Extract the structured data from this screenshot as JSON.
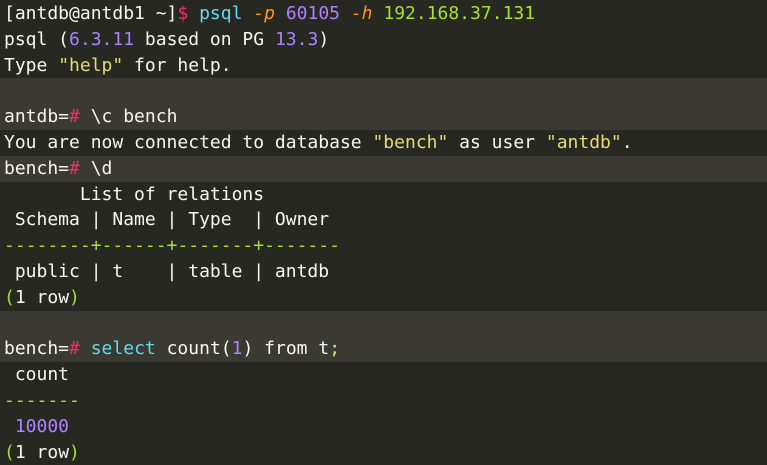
{
  "terminal": {
    "prompt_host": "[antdb@antdb1 ~]",
    "prompt_symbol": "$",
    "cmd_psql": "psql",
    "flag_p": "-p",
    "port": "60105",
    "flag_h": "-h",
    "host": "192.168.37.131",
    "version_prefix": "psql (",
    "version": "6.3.11",
    "version_middle": " based on PG ",
    "pg_version": "13.3",
    "version_suffix": ")",
    "help_prefix": "Type ",
    "help_word": "\"help\"",
    "help_suffix": " for help.",
    "antdb_prompt": "antdb=",
    "hash": "#",
    "cmd_connect": " \\c bench",
    "connected_prefix": "You are now connected to database ",
    "db_name": "\"bench\"",
    "connected_middle": " as user ",
    "user_name": "\"antdb\"",
    "connected_suffix": ".",
    "bench_prompt": "bench=",
    "cmd_d": " \\d",
    "relations_title": "       List of relations",
    "relations_header": " Schema | Name | Type  | Owner",
    "relations_sep": "--------+------+-------+-------",
    "relations_row": " public | t    | table | antdb",
    "row_count_1": "(1 row)",
    "select_kw": "select",
    "count_fn": "count(",
    "count_arg": "1",
    "count_close": ")",
    "from_kw": "from",
    "table_t": "t",
    "semicolon": ";",
    "count_header": " count",
    "count_sep": "-------",
    "count_value": " 10000",
    "row_count_2": "(1 row)"
  }
}
